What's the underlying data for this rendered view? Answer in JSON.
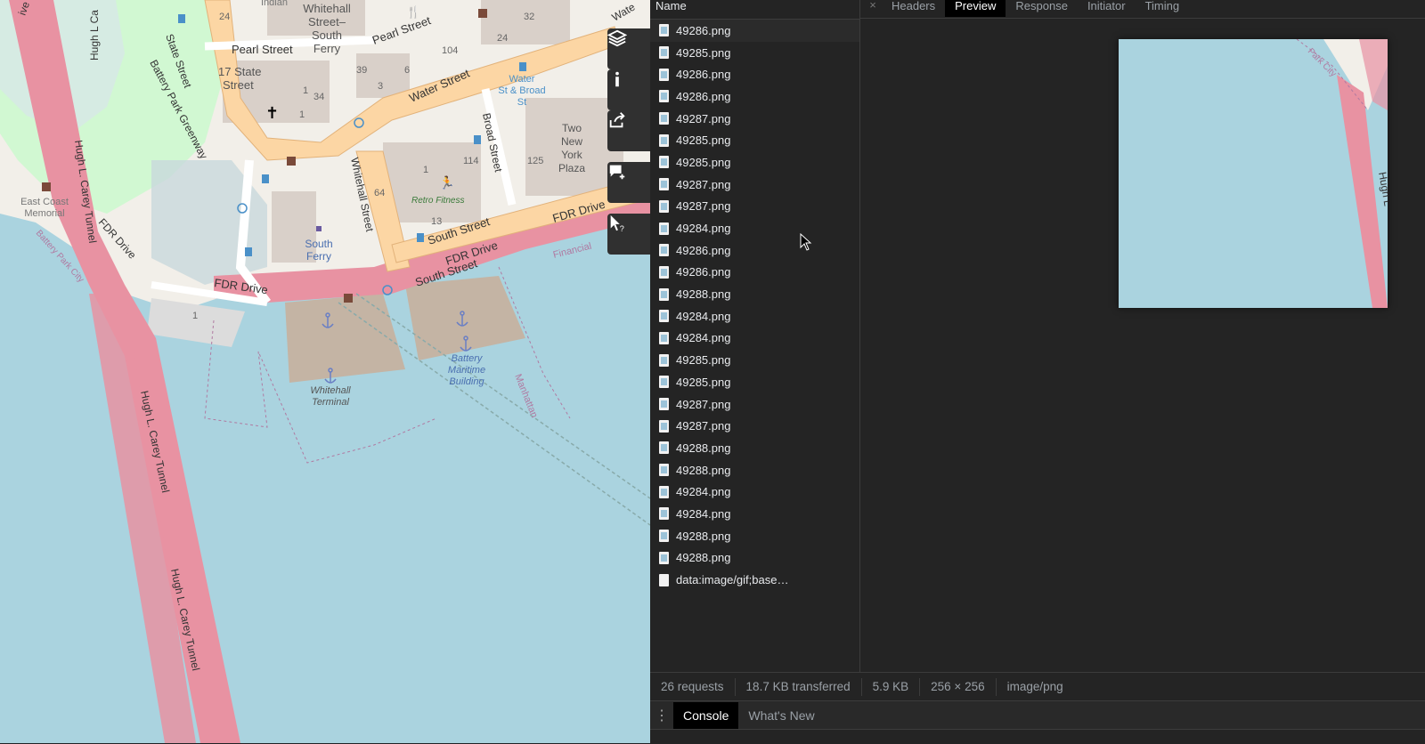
{
  "map": {
    "labels": {
      "whitehall_street_south_ferry": "Whitehall\nStreet–\nSouth\nFerry",
      "indian": "Indian",
      "pearl_street_1": "Pearl Street",
      "pearl_street_2": "Pearl Street",
      "state_street": "State Street",
      "battery_park_greenway": "Battery Park Greenway",
      "seventeen_state": "17 State\nStreet",
      "water_street": "Water Street",
      "water_st_broad": "Water\nSt & Broad\nSt",
      "broad_street": "Broad Street",
      "whitehall_street": "Whitehall Street",
      "two_new_york_plaza": "Two\nNew\nYork\nPlaza",
      "retro_fitness": "Retro Fitness",
      "south_street_1": "South Street",
      "south_street_2": "South Street",
      "fdr_drive_1": "FDR Drive",
      "fdr_drive_2": "FDR Drive",
      "fdr_drive_3": "FDR Drive",
      "fdr_drive_4": "FDR Drive",
      "south_ferry": "South\nFerry",
      "east_coast_memorial": "East Coast\nMemorial",
      "hugh_carey_1": "Hugh L. Carey Tunnel",
      "hugh_carey_2": "Hugh L. Carey Tunnel",
      "hugh_carey_3": "Hugh L. Carey Tunnel",
      "hugh_carey_top": "Hugh L Ca",
      "battery_park_city": "Battery Park City",
      "whitehall_terminal": "Whitehall\nTerminal",
      "battery_maritime": "Battery\nMaritime\nBuilding",
      "manhattan": "Manhattan",
      "financial": "Financial",
      "ive": "ive",
      "wate": "Wate",
      "hugh_l_preview": "Hugh L",
      "park_city_preview": "Park City",
      "num_24a": "24",
      "num_32": "32",
      "num_24b": "24",
      "num_104": "104",
      "num_39": "39",
      "num_6": "6",
      "num_3": "3",
      "num_1a": "1",
      "num_34": "34",
      "num_1b": "1",
      "num_114": "114",
      "num_125": "125",
      "num_64": "64",
      "num_13": "13",
      "num_1c": "1",
      "num_1d": "1"
    },
    "tools": [
      {
        "name": "layers",
        "icon": "layers-icon"
      },
      {
        "name": "info",
        "icon": "info-icon"
      },
      {
        "name": "share",
        "icon": "share-icon"
      },
      {
        "name": "note",
        "icon": "add-note-icon"
      },
      {
        "name": "query",
        "icon": "query-features-icon"
      }
    ]
  },
  "devtools": {
    "list_header": "Name",
    "requests": [
      {
        "name": "49286.png",
        "kind": "png"
      },
      {
        "name": "49285.png",
        "kind": "png"
      },
      {
        "name": "49286.png",
        "kind": "png"
      },
      {
        "name": "49286.png",
        "kind": "png"
      },
      {
        "name": "49287.png",
        "kind": "png"
      },
      {
        "name": "49285.png",
        "kind": "png"
      },
      {
        "name": "49285.png",
        "kind": "png"
      },
      {
        "name": "49287.png",
        "kind": "png"
      },
      {
        "name": "49287.png",
        "kind": "png"
      },
      {
        "name": "49284.png",
        "kind": "png"
      },
      {
        "name": "49286.png",
        "kind": "png"
      },
      {
        "name": "49286.png",
        "kind": "png"
      },
      {
        "name": "49288.png",
        "kind": "png"
      },
      {
        "name": "49284.png",
        "kind": "png"
      },
      {
        "name": "49284.png",
        "kind": "png"
      },
      {
        "name": "49285.png",
        "kind": "png"
      },
      {
        "name": "49285.png",
        "kind": "png"
      },
      {
        "name": "49287.png",
        "kind": "png"
      },
      {
        "name": "49287.png",
        "kind": "png"
      },
      {
        "name": "49288.png",
        "kind": "png"
      },
      {
        "name": "49288.png",
        "kind": "png"
      },
      {
        "name": "49284.png",
        "kind": "png"
      },
      {
        "name": "49284.png",
        "kind": "png"
      },
      {
        "name": "49288.png",
        "kind": "png"
      },
      {
        "name": "49288.png",
        "kind": "png"
      },
      {
        "name": "data:image/gif;base…",
        "kind": "data"
      }
    ],
    "tabs": [
      "Headers",
      "Preview",
      "Response",
      "Initiator",
      "Timing"
    ],
    "active_tab": "Preview",
    "close_glyph": "×",
    "status": {
      "requests": "26 requests",
      "transferred": "18.7 KB transferred",
      "size": "5.9 KB",
      "dimensions": "256 × 256",
      "mime": "image/png"
    },
    "drawer": {
      "menu_glyph": "⋮",
      "tabs": [
        "Console",
        "What's New"
      ],
      "active_tab": "Console"
    }
  },
  "colors": {
    "water": "#aad3df",
    "land": "#f2efe9",
    "primary_road": "#fcd6a4",
    "motorway": "#e892a2",
    "park": "#c8facc",
    "building": "#d9d0c9",
    "pier": "#c4b4a4",
    "devtools_bg": "#242424"
  }
}
